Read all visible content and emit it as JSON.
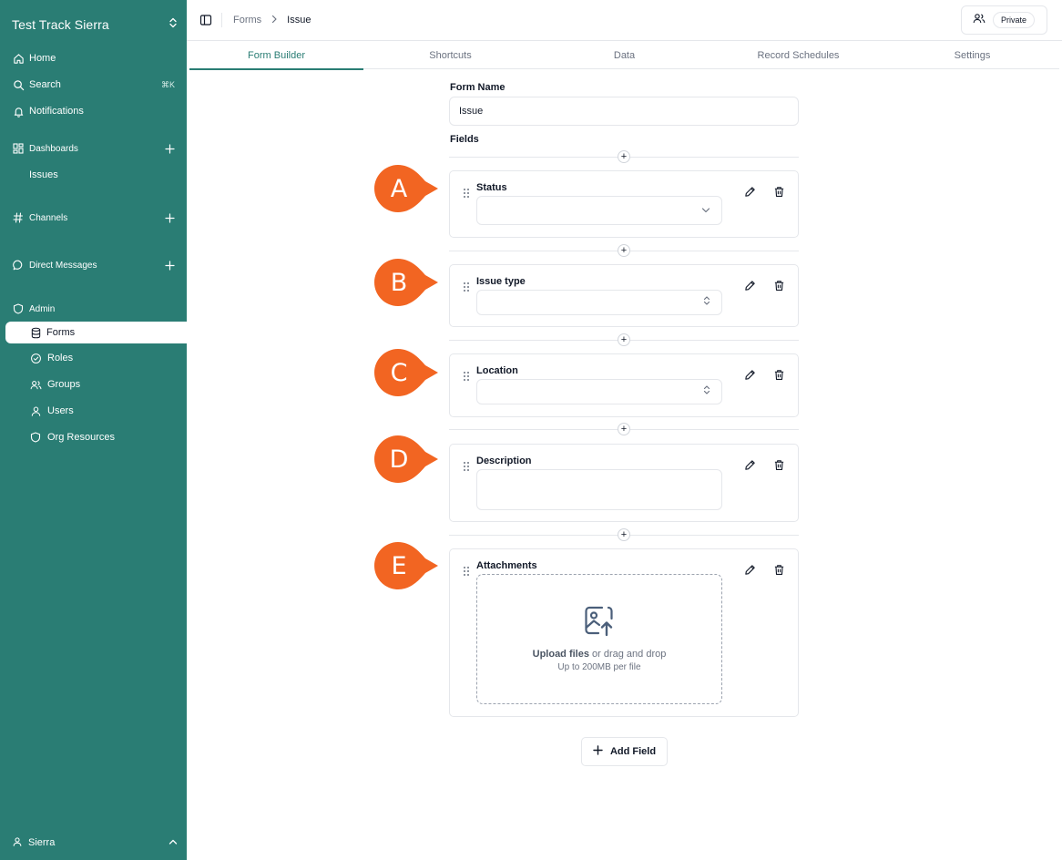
{
  "sidebar": {
    "workspace_name": "Test Track Sierra",
    "nav": {
      "home": "Home",
      "search": "Search",
      "search_shortcut": "⌘K",
      "notifications": "Notifications"
    },
    "sections": {
      "dashboards": "Dashboards",
      "issues": "Issues",
      "channels": "Channels",
      "direct_messages": "Direct Messages",
      "admin": "Admin"
    },
    "admin_items": {
      "forms": "Forms",
      "roles": "Roles",
      "groups": "Groups",
      "users": "Users",
      "org_resources": "Org Resources"
    },
    "user": "Sierra"
  },
  "header": {
    "breadcrumb": [
      "Forms",
      "Issue"
    ],
    "privacy": "Private"
  },
  "tabs": [
    "Form Builder",
    "Shortcuts",
    "Data",
    "Record Schedules",
    "Settings"
  ],
  "active_tab": "Form Builder",
  "form": {
    "name_label": "Form Name",
    "name_value": "Issue",
    "fields_label": "Fields",
    "fields": [
      {
        "marker": "A",
        "label": "Status",
        "type": "select"
      },
      {
        "marker": "B",
        "label": "Issue type",
        "type": "combobox"
      },
      {
        "marker": "C",
        "label": "Location",
        "type": "combobox"
      },
      {
        "marker": "D",
        "label": "Description",
        "type": "textarea"
      },
      {
        "marker": "E",
        "label": "Attachments",
        "type": "file"
      }
    ],
    "upload": {
      "link": "Upload files",
      "text": " or drag and drop",
      "limit": "Up to 200MB per file"
    },
    "add_field": "Add Field"
  },
  "colors": {
    "sidebar_bg": "#2a7d74",
    "marker": "#f26522",
    "accent": "#2a7d74"
  }
}
